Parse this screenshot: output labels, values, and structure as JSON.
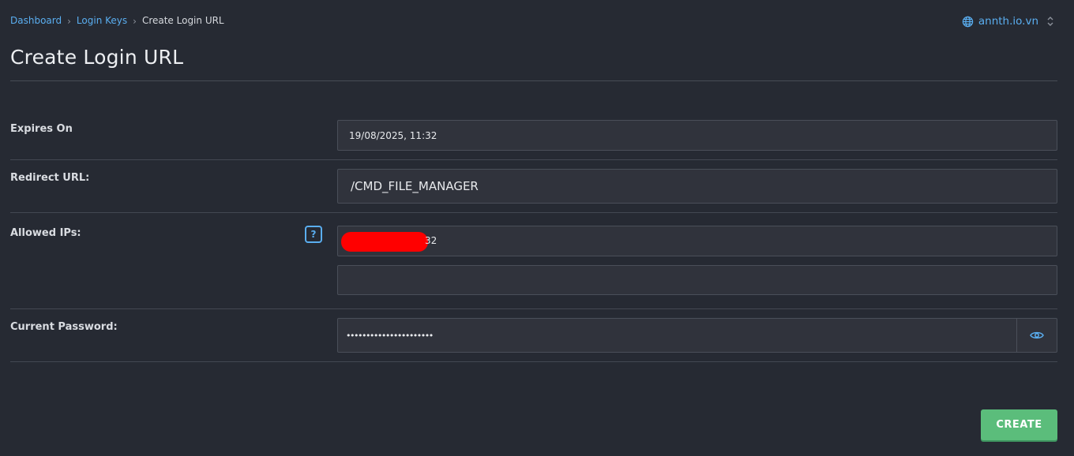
{
  "breadcrumb": {
    "items": [
      "Dashboard",
      "Login Keys"
    ],
    "current": "Create Login URL"
  },
  "domain_switch": {
    "icon": "globe-icon",
    "label": "annth.io.vn",
    "chevron_icon": "updown-chevron-icon"
  },
  "page_title": "Create Login URL",
  "form": {
    "expires_on": {
      "label": "Expires On",
      "value": "19/08/2025, 11:32"
    },
    "redirect_url": {
      "label": "Redirect URL:",
      "value": "/CMD_FILE_MANAGER"
    },
    "allowed_ips": {
      "label": "Allowed IPs:",
      "help_label": "?",
      "ip1_visible_suffix": "32",
      "ip2_value": ""
    },
    "current_password": {
      "label": "Current Password:",
      "value": "••••••••••••••••••••••",
      "toggle_icon": "eye-icon"
    }
  },
  "create_button": "CREATE",
  "colors": {
    "background": "#262a33",
    "link": "#5aaef0",
    "field_bg": "#30333c",
    "create_green": "#5bbd7b",
    "redaction": "#ff0000"
  }
}
